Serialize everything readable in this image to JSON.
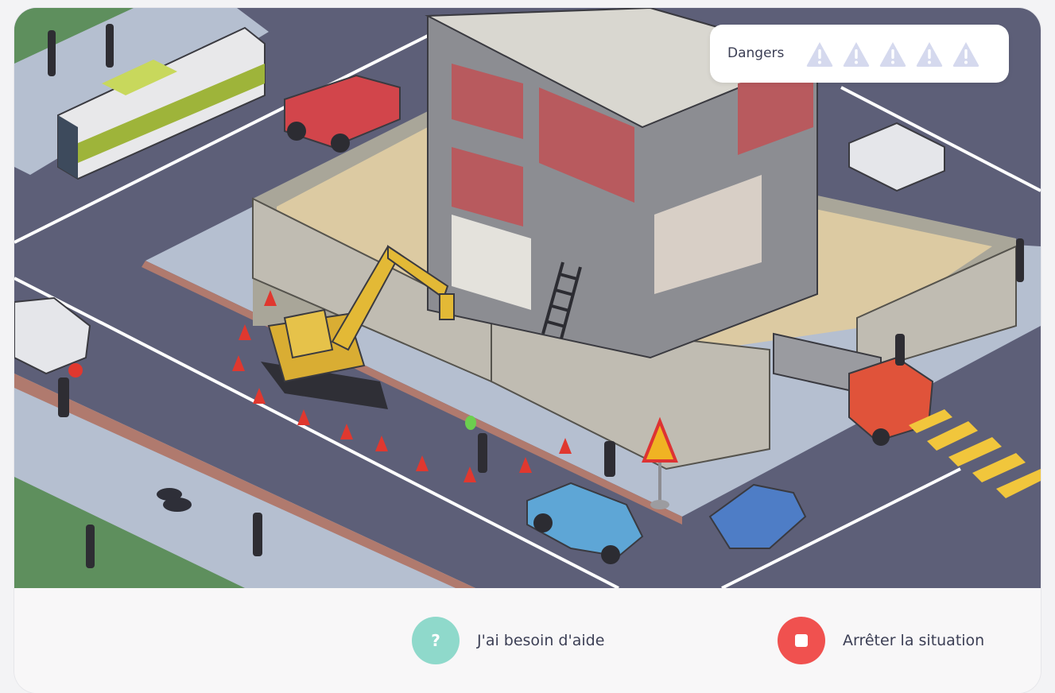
{
  "hud": {
    "dangers_label": "Dangers",
    "danger_icons": [
      "warning-icon",
      "warning-icon",
      "warning-icon",
      "warning-icon",
      "warning-icon"
    ],
    "danger_icon_color": "#d5d9ee"
  },
  "actions": {
    "help_label": "J'ai besoin d'aide",
    "help_icon_glyph": "?",
    "help_color": "#8fd9cb",
    "stop_label": "Arrêter la situation",
    "stop_color": "#f0514f"
  },
  "scene": {
    "colors": {
      "road": "#5d5f78",
      "sidewalk": "#b5bfd0",
      "grass": "#5e8f5d",
      "curb": "#b07a6e",
      "concrete": "#bdbab1",
      "sand": "#dccaa2"
    }
  }
}
